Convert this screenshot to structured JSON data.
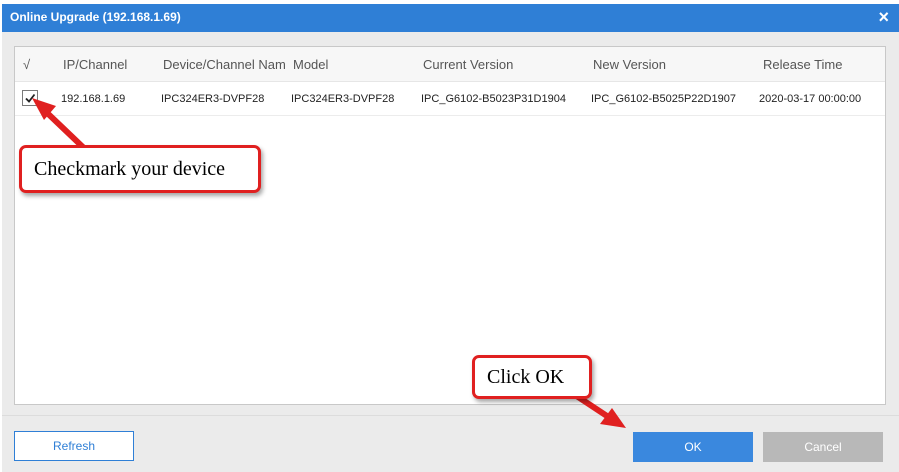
{
  "dialog": {
    "title": "Online Upgrade (192.168.1.69)",
    "close_symbol": "×"
  },
  "table": {
    "columns": [
      "√",
      "IP/Channel",
      "Device/Channel Nam",
      "Model",
      "Current Version",
      "New Version",
      "Release Time"
    ],
    "rows": [
      {
        "checked": true,
        "ip": "192.168.1.69",
        "device": "IPC324ER3-DVPF28",
        "model": "IPC324ER3-DVPF28",
        "current_version": "IPC_G6102-B5023P31D1904",
        "new_version": "IPC_G6102-B5025P22D1907",
        "release_time": "2020-03-17 00:00:00"
      }
    ]
  },
  "annotations": {
    "checkmark_note": "Checkmark your device",
    "ok_note": "Click OK",
    "color": "#e02020"
  },
  "buttons": {
    "refresh": "Refresh",
    "ok": "OK",
    "cancel": "Cancel"
  },
  "colors": {
    "titlebar": "#2f7fd6",
    "ok_button": "#3a88de",
    "cancel_button": "#b8b8b8"
  }
}
